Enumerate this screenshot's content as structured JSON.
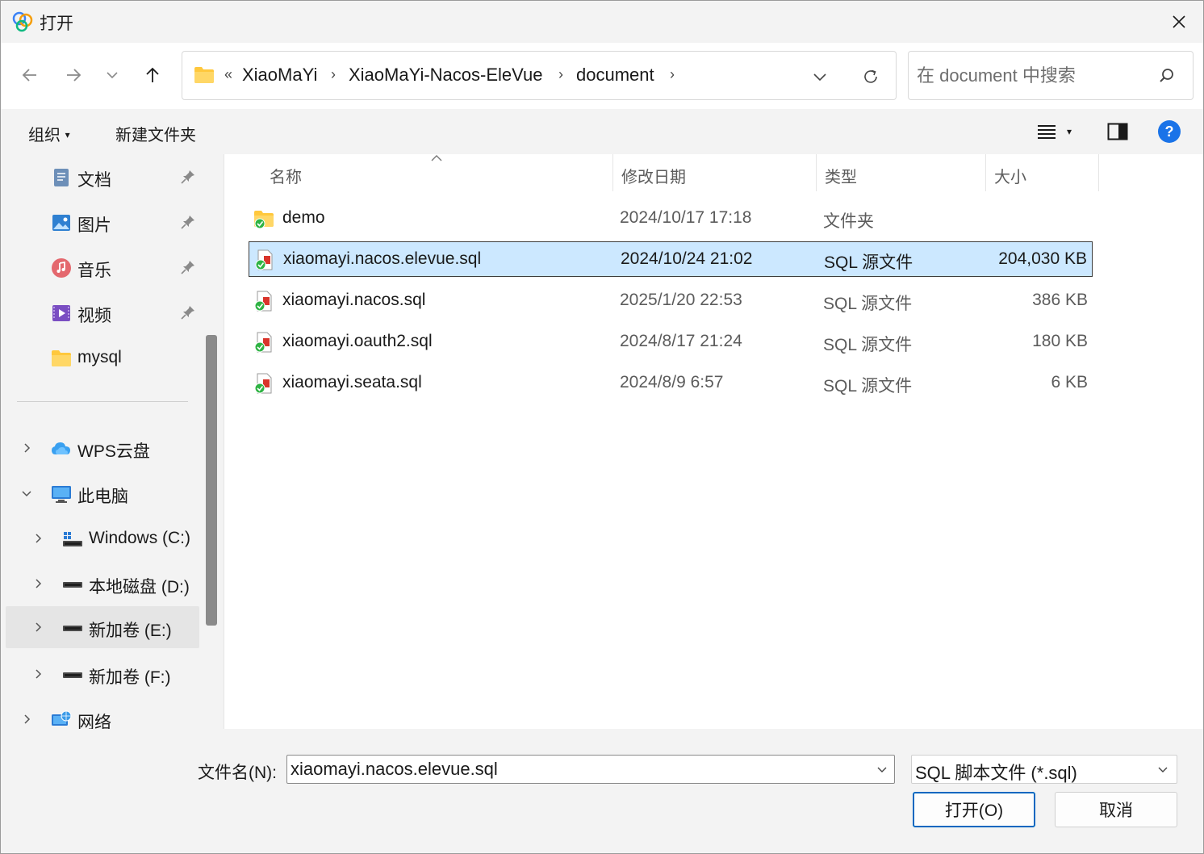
{
  "window": {
    "title": "打开"
  },
  "nav": {
    "address_overflow": "«",
    "breadcrumbs": [
      "XiaoMaYi",
      "XiaoMaYi-Nacos-EleVue",
      "document"
    ],
    "search_placeholder": "在 document 中搜索"
  },
  "toolbar": {
    "organize_label": "组织",
    "new_folder_label": "新建文件夹"
  },
  "sidebar": {
    "quick_access": [
      {
        "label": "文档",
        "icon": "documents-icon",
        "pinned": true
      },
      {
        "label": "图片",
        "icon": "pictures-icon",
        "pinned": true
      },
      {
        "label": "音乐",
        "icon": "music-icon",
        "pinned": true
      },
      {
        "label": "视频",
        "icon": "videos-icon",
        "pinned": true
      },
      {
        "label": "mysql",
        "icon": "folder-icon",
        "pinned": false
      }
    ],
    "tree": [
      {
        "label": "WPS云盘",
        "icon": "cloud-icon",
        "expander": "collapsed"
      },
      {
        "label": "此电脑",
        "icon": "computer-icon",
        "expander": "expanded"
      },
      {
        "label": "Windows (C:)",
        "icon": "windows-drive-icon",
        "expander": "collapsed"
      },
      {
        "label": "本地磁盘 (D:)",
        "icon": "drive-icon",
        "expander": "collapsed"
      },
      {
        "label": "新加卷 (E:)",
        "icon": "drive-icon",
        "expander": "collapsed",
        "selected": true
      },
      {
        "label": "新加卷 (F:)",
        "icon": "drive-icon",
        "expander": "collapsed"
      },
      {
        "label": "网络",
        "icon": "network-icon",
        "expander": "collapsed"
      }
    ]
  },
  "columns": {
    "name": "名称",
    "date": "修改日期",
    "type": "类型",
    "size": "大小"
  },
  "files": [
    {
      "name": "demo",
      "date": "2024/10/17 17:18",
      "type": "文件夹",
      "size": "",
      "icon": "folder-icon",
      "selected": false
    },
    {
      "name": "xiaomayi.nacos.elevue.sql",
      "date": "2024/10/24 21:02",
      "type": "SQL 源文件",
      "size": "204,030 KB",
      "icon": "sql-file-icon",
      "selected": true
    },
    {
      "name": "xiaomayi.nacos.sql",
      "date": "2025/1/20 22:53",
      "type": "SQL 源文件",
      "size": "386 KB",
      "icon": "sql-file-icon",
      "selected": false
    },
    {
      "name": "xiaomayi.oauth2.sql",
      "date": "2024/8/17 21:24",
      "type": "SQL 源文件",
      "size": "180 KB",
      "icon": "sql-file-icon",
      "selected": false
    },
    {
      "name": "xiaomayi.seata.sql",
      "date": "2024/8/9 6:57",
      "type": "SQL 源文件",
      "size": "6 KB",
      "icon": "sql-file-icon",
      "selected": false
    }
  ],
  "footer": {
    "filename_label": "文件名(N):",
    "filename_value": "xiaomayi.nacos.elevue.sql",
    "filetype_value": "SQL 脚本文件 (*.sql)",
    "open_label": "打开(O)",
    "cancel_label": "取消"
  },
  "colors": {
    "accent": "#0067c0",
    "selection": "#cce8ff",
    "help": "#1a73e8",
    "folder": "#ffc83d"
  }
}
